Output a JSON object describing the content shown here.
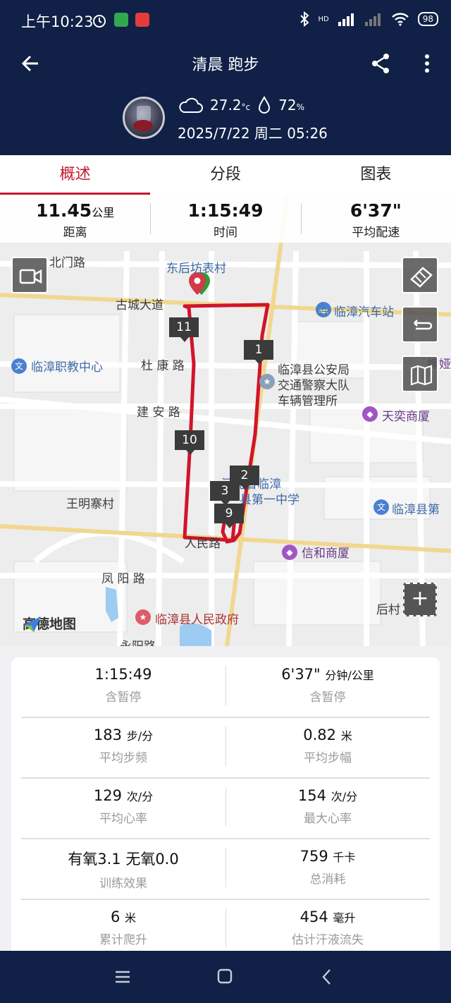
{
  "status": {
    "time": "上午10:23",
    "battery": "98",
    "hd": "HD"
  },
  "appbar": {
    "title": "清晨 跑步"
  },
  "header": {
    "temperature": "27.2",
    "temperature_unit": "°c",
    "humidity": "72",
    "humidity_unit": "%",
    "datetime": "2025/7/22 周二 05:26"
  },
  "tabs": [
    {
      "label": "概述",
      "active": true
    },
    {
      "label": "分段",
      "active": false
    },
    {
      "label": "图表",
      "active": false
    }
  ],
  "top_stats": [
    {
      "value": "11.45",
      "unit": "公里",
      "label": "距离"
    },
    {
      "value": "1:15:49",
      "unit": "",
      "label": "时间"
    },
    {
      "value": "6'37\"",
      "unit": "",
      "label": "平均配速"
    }
  ],
  "map": {
    "labels": {
      "beimen": "北门路",
      "donghou": "东后坊表村",
      "gucheng": "古城大道",
      "qiche": "临漳汽车站",
      "zhijiao": "临漳职教中心",
      "dukang": "杜 康 路",
      "gongan1": "临漳县公安局",
      "gongan2": "交通警察大队",
      "gongan3": "车辆管理所",
      "jianan": "建 安 路",
      "tianyi": "天奕商厦",
      "linzhang1": "河北省临漳",
      "linzhang2": "县第一中学",
      "wangming": "王明寨村",
      "linzhang_di": "临漳县第",
      "renmin": "人民路",
      "xinhe": "信和商厦",
      "fengyang": "凤 阳 路",
      "houcun": "后村",
      "zhengfu": "临漳县人民政府",
      "yongyang": "永阳路",
      "edge1": "婶娅"
    },
    "km_markers": [
      "1",
      "2",
      "3",
      "9",
      "10",
      "11"
    ],
    "brand": "高德地图",
    "route_color": "#d0142c"
  },
  "summary": [
    [
      {
        "value": "1:15:49",
        "unit": "",
        "label": "含暂停"
      },
      {
        "value": "6'37\"",
        "unit": "分钟/公里",
        "label": "含暂停"
      }
    ],
    [
      {
        "value": "183",
        "unit": "步/分",
        "label": "平均步频"
      },
      {
        "value": "0.82",
        "unit": "米",
        "label": "平均步幅"
      }
    ],
    [
      {
        "value": "129",
        "unit": "次/分",
        "label": "平均心率"
      },
      {
        "value": "154",
        "unit": "次/分",
        "label": "最大心率"
      }
    ],
    [
      {
        "value": "有氧3.1 无氧0.0",
        "unit": "",
        "label": "训练效果"
      },
      {
        "value": "759",
        "unit": "千卡",
        "label": "总消耗"
      }
    ],
    [
      {
        "value": "6",
        "unit": "米",
        "label": "累计爬升"
      },
      {
        "value": "454",
        "unit": "毫升",
        "label": "估计汗液流失"
      }
    ]
  ],
  "colors": {
    "header_bg": "#102046",
    "accent": "#c4182f"
  }
}
